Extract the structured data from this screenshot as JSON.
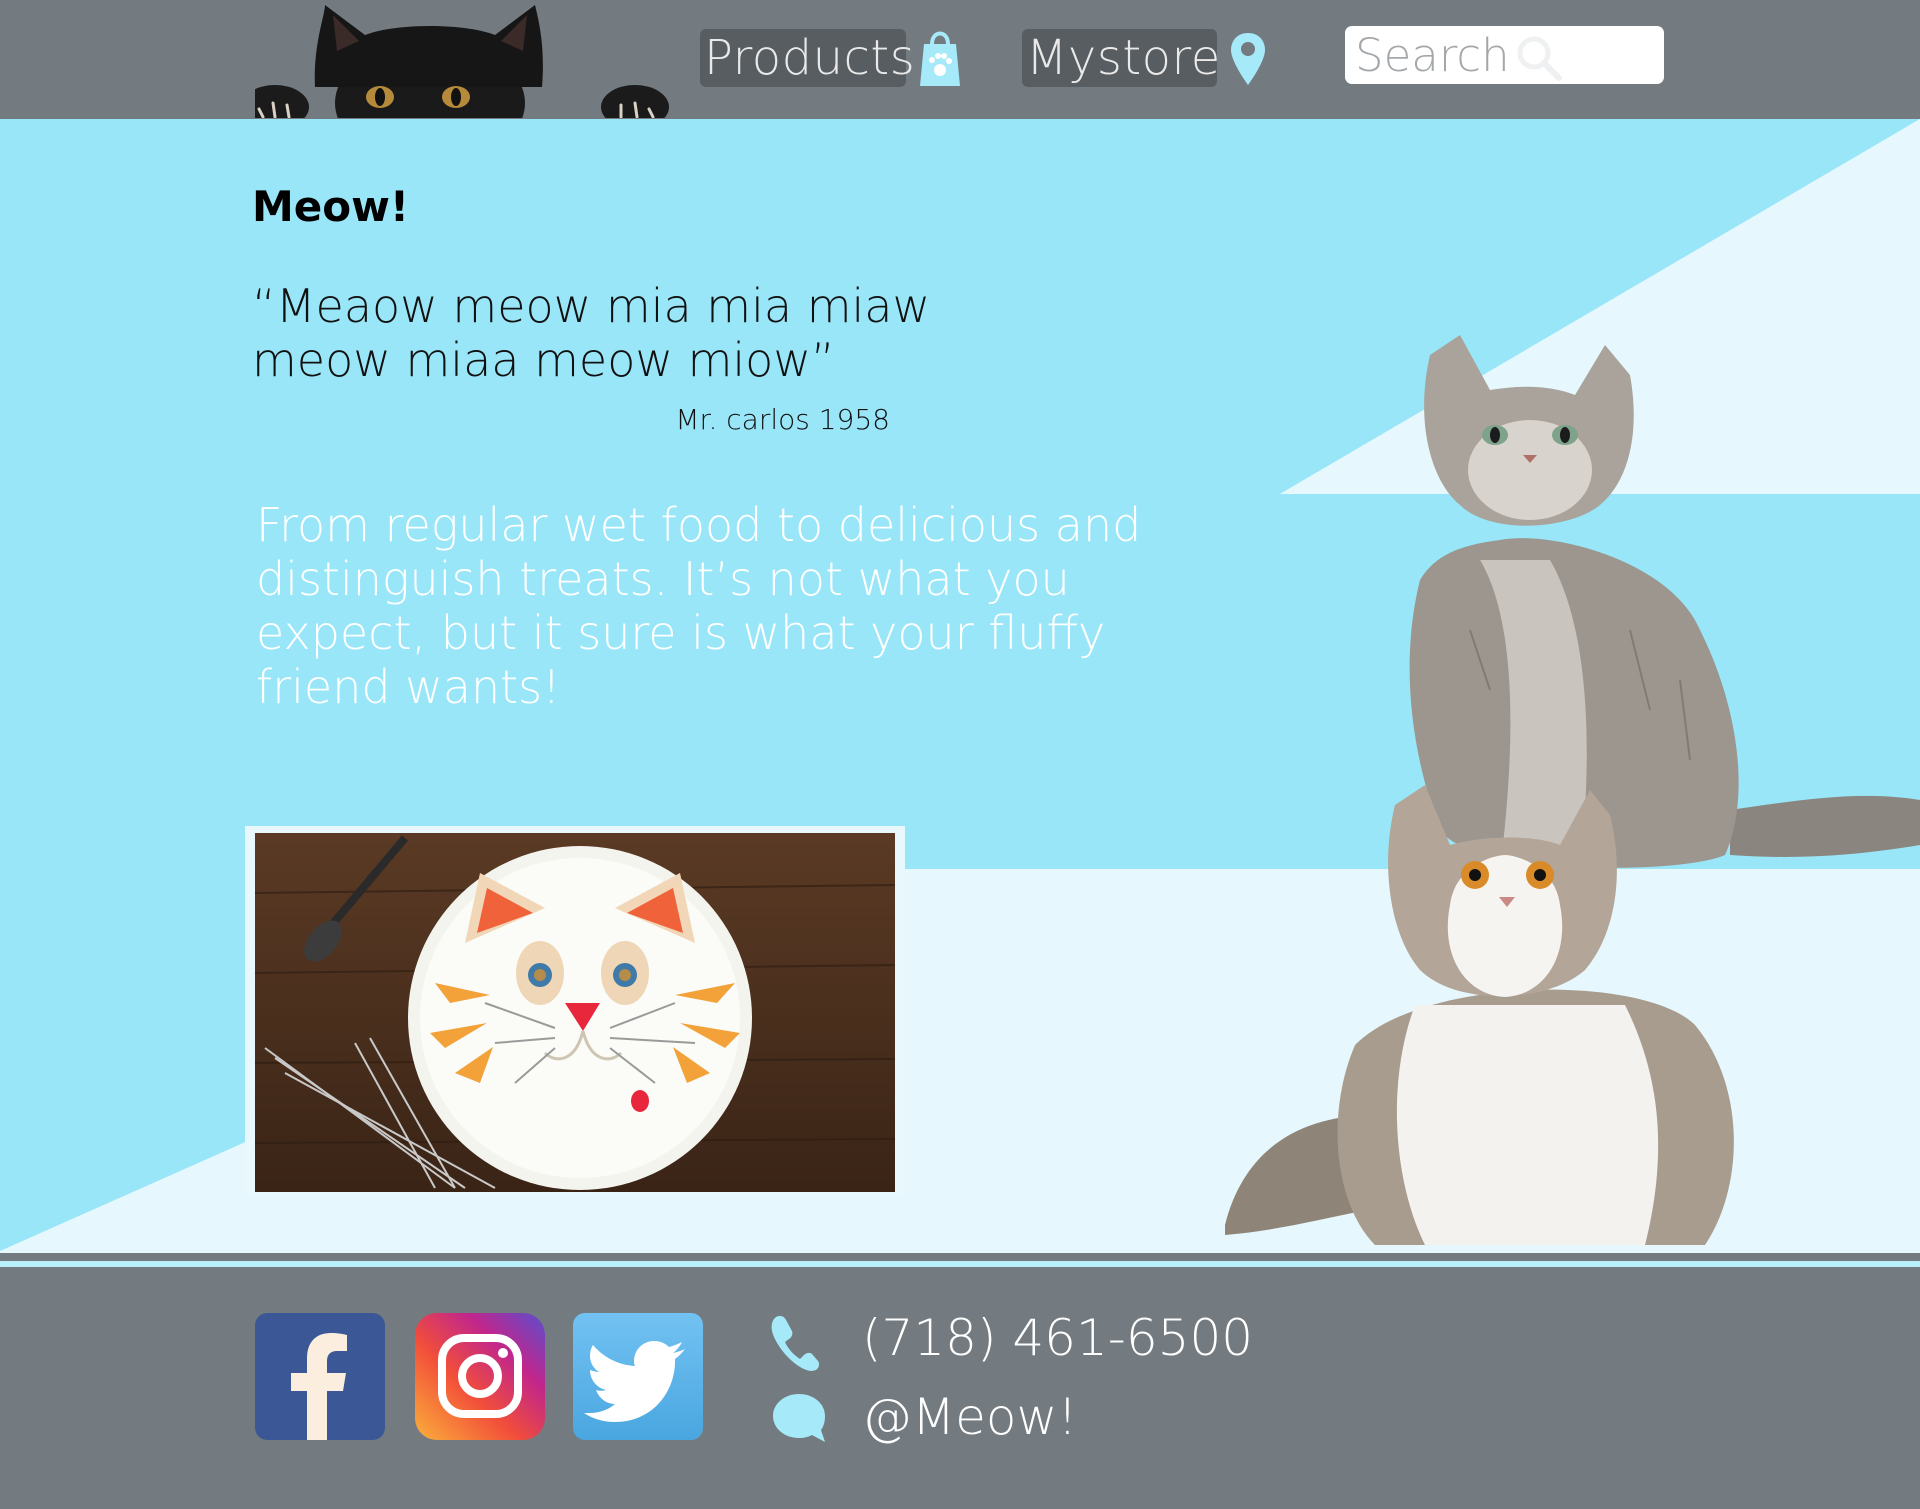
{
  "header": {
    "nav": {
      "products_label": "Products",
      "mystore_label": "Mystore"
    },
    "search": {
      "placeholder": "Search",
      "value": ""
    },
    "icons": [
      "cat-logo-icon",
      "shopping-bag-icon",
      "map-pin-icon",
      "search-icon"
    ]
  },
  "hero": {
    "title": "Meow!",
    "quote": "“Meaow meow mia mia miaw\n meow miaa meow miow”",
    "quote_attribution": "Mr. carlos 1958",
    "blurb": "From regular wet food to delicious and distinguish treats. It’s not what you expect, but it sure is what your fluffy friend wants!",
    "images": [
      "cat-face-cake-photo",
      "grey-fluffy-cat-photo",
      "white-grey-cat-photo"
    ]
  },
  "footer": {
    "social": [
      "facebook-icon",
      "instagram-icon",
      "twitter-icon"
    ],
    "phone": "(718) 461-6500",
    "handle": "@Meow!"
  },
  "colors": {
    "header_bg": "#737b80",
    "hero_blue": "#99e6f8",
    "hero_light": "#e6f8fd",
    "accent_icon": "#a6e9f8",
    "nav_button_bg": "#585d61"
  }
}
